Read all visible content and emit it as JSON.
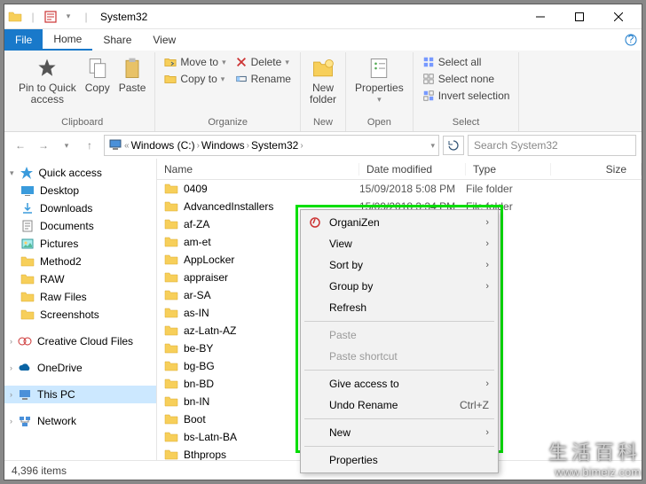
{
  "window": {
    "title": "System32"
  },
  "tabs": {
    "file": "File",
    "home": "Home",
    "share": "Share",
    "view": "View"
  },
  "ribbon": {
    "clipboard": {
      "label": "Clipboard",
      "pin": "Pin to Quick\naccess",
      "copy": "Copy",
      "paste": "Paste"
    },
    "organize": {
      "label": "Organize",
      "move": "Move to",
      "copy": "Copy to",
      "delete": "Delete",
      "rename": "Rename"
    },
    "new": {
      "label": "New",
      "folder": "New\nfolder"
    },
    "open": {
      "label": "Open",
      "properties": "Properties"
    },
    "select": {
      "label": "Select",
      "all": "Select all",
      "none": "Select none",
      "invert": "Invert selection"
    }
  },
  "breadcrumbs": [
    "Windows (C:)",
    "Windows",
    "System32"
  ],
  "search": {
    "placeholder": "Search System32"
  },
  "columns": {
    "name": "Name",
    "date": "Date modified",
    "type": "Type",
    "size": "Size"
  },
  "sidebar": {
    "quick": "Quick access",
    "items1": [
      "Desktop",
      "Downloads",
      "Documents",
      "Pictures",
      "Method2",
      "RAW",
      "Raw Files",
      "Screenshots"
    ],
    "ccf": "Creative Cloud Files",
    "onedrive": "OneDrive",
    "thispc": "This PC",
    "network": "Network"
  },
  "files": [
    {
      "name": "0409",
      "date": "15/09/2018 5:08 PM",
      "type": "File folder"
    },
    {
      "name": "AdvancedInstallers",
      "date": "15/09/2018 3:34 PM",
      "type": "File folder"
    },
    {
      "name": "af-ZA",
      "date": "",
      "type": "der"
    },
    {
      "name": "am-et",
      "date": "",
      "type": "der"
    },
    {
      "name": "AppLocker",
      "date": "",
      "type": "der"
    },
    {
      "name": "appraiser",
      "date": "",
      "type": "der"
    },
    {
      "name": "ar-SA",
      "date": "",
      "type": "der"
    },
    {
      "name": "as-IN",
      "date": "",
      "type": "der"
    },
    {
      "name": "az-Latn-AZ",
      "date": "",
      "type": "der"
    },
    {
      "name": "be-BY",
      "date": "",
      "type": "der"
    },
    {
      "name": "bg-BG",
      "date": "",
      "type": "der"
    },
    {
      "name": "bn-BD",
      "date": "",
      "type": "der"
    },
    {
      "name": "bn-IN",
      "date": "",
      "type": "der"
    },
    {
      "name": "Boot",
      "date": "",
      "type": "der"
    },
    {
      "name": "bs-Latn-BA",
      "date": "",
      "type": "der"
    },
    {
      "name": "Bthprops",
      "date": "",
      "type": "der"
    }
  ],
  "context": {
    "organizen": "OrganiZen",
    "view": "View",
    "sort": "Sort by",
    "group": "Group by",
    "refresh": "Refresh",
    "paste": "Paste",
    "paste_shortcut": "Paste shortcut",
    "access": "Give access to",
    "undo": "Undo Rename",
    "undo_key": "Ctrl+Z",
    "new": "New",
    "props": "Properties"
  },
  "status": {
    "count": "4,396 items"
  },
  "watermark": {
    "cn": "生活百科",
    "url": "www.bimeiz.com"
  }
}
